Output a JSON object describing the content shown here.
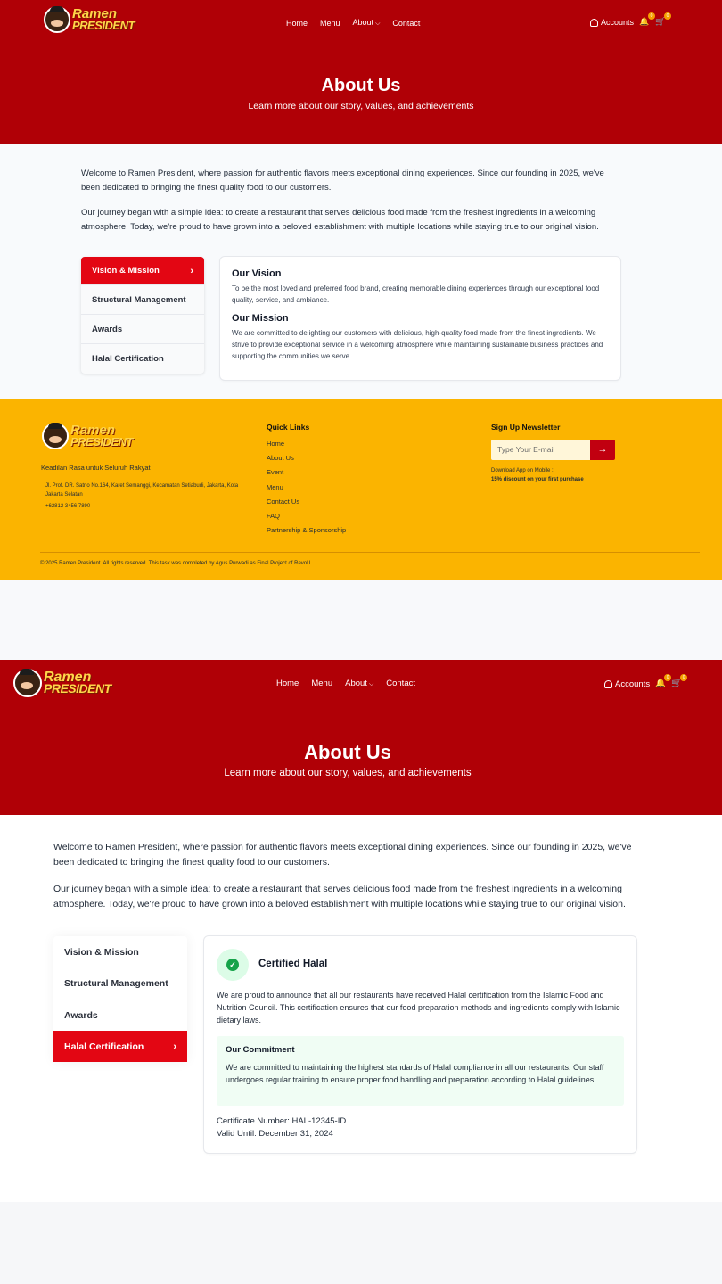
{
  "brand": {
    "line1": "Ramen",
    "line2": "PRESIDENT"
  },
  "nav": {
    "home": "Home",
    "menu": "Menu",
    "about": "About",
    "contact": "Contact",
    "accounts": "Accounts",
    "notif_count": "0",
    "cart_count": "0"
  },
  "hero": {
    "title": "About Us",
    "subtitle": "Learn more about our story, values, and achievements"
  },
  "intro": {
    "p1": "Welcome to Ramen President, where passion for authentic flavors meets exceptional dining experiences. Since our founding in 2025, we've been dedicated to bringing the finest quality food to our customers.",
    "p2": "Our journey began with a simple idea: to create a restaurant that serves delicious food made from the freshest ingredients in a welcoming atmosphere. Today, we're proud to have grown into a beloved establishment with multiple locations while staying true to our original vision."
  },
  "tabs": [
    "Vision & Mission",
    "Structural Management",
    "Awards",
    "Halal Certification"
  ],
  "vision": {
    "vision_title": "Our Vision",
    "vision_text": "To be the most loved and preferred food brand, creating memorable dining experiences through our exceptional food quality, service, and ambiance.",
    "mission_title": "Our Mission",
    "mission_text": "We are committed to delighting our customers with delicious, high-quality food made from the finest ingredients. We strive to provide exceptional service in a welcoming atmosphere while maintaining sustainable business practices and supporting the communities we serve."
  },
  "footer": {
    "tagline": "Keadilan Rasa untuk Seluruh Rakyat",
    "address": "Jl. Prof. DR. Satrio No.164, Karet Semanggi, Kecamatan Setiabudi, Jakarta, Kota Jakarta Selatan",
    "phone": "+62812 3456 7890",
    "links_title": "Quick Links",
    "links": [
      "Home",
      "About Us",
      "Event",
      "Menu",
      "Contact Us",
      "FAQ",
      "Partnership & Sponsorship"
    ],
    "newsletter_title": "Sign Up Newsletter",
    "email_placeholder": "Type Your E-mail",
    "submit_arrow": "→",
    "app_line1": "Download App on Mobile :",
    "app_line2": "15% discount on your first purchase",
    "copyright": "© 2025 Ramen President. All rights reserved. This task was completed by Agus Purwadi as Final Project of RevoU"
  },
  "halal": {
    "title": "Certified Halal",
    "text": "We are proud to announce that all our restaurants have received Halal certification from the Islamic Food and Nutrition Council. This certification ensures that our food preparation methods and ingredients comply with Islamic dietary laws.",
    "commit_title": "Our Commitment",
    "commit_text": "We are committed to maintaining the highest standards of Halal compliance in all our restaurants. Our staff undergoes regular training to ensure proper food handling and preparation according to Halal guidelines.",
    "cert_number": "Certificate Number: HAL-12345-ID",
    "valid_until": "Valid Until: December 31, 2024"
  },
  "colors": {
    "brand_red": "#b00006",
    "active_tab": "#e30613",
    "footer_yellow": "#fbb400",
    "halal_green": "#16a34a"
  },
  "icons": [
    "user-icon",
    "bell-icon",
    "cart-icon",
    "chevron-down-icon",
    "chevron-right-icon",
    "check-icon",
    "arrow-right-icon"
  ]
}
